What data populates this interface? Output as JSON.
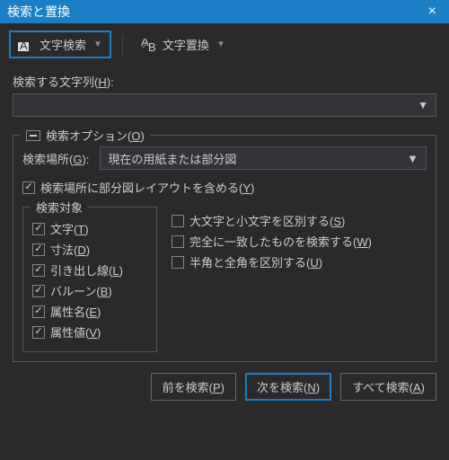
{
  "titlebar": {
    "title": "検索と置換"
  },
  "tabs": {
    "search": "文字検索",
    "replace": "文字置換"
  },
  "searchString": {
    "label": "検索する文字列(",
    "key": "H",
    "suffix": "):"
  },
  "options": {
    "legend": "検索オプション(",
    "legendKey": "O",
    "legendSuffix": ")",
    "locationLabel": "検索場所(",
    "locationKey": "G",
    "locationSuffix": "):",
    "locationValue": "現在の用紙または部分図",
    "includeLayout": "検索場所に部分図レイアウトを含める(",
    "includeLayoutKey": "Y",
    "includeLayoutSuffix": ")",
    "targetLegend": "検索対象",
    "targets": {
      "text": {
        "label": "文字(",
        "key": "T",
        "suffix": ")"
      },
      "dim": {
        "label": "寸法(",
        "key": "D",
        "suffix": ")"
      },
      "leader": {
        "label": "引き出し線(",
        "key": "L",
        "suffix": ")"
      },
      "balloon": {
        "label": "バルーン(",
        "key": "B",
        "suffix": ")"
      },
      "attrname": {
        "label": "属性名(",
        "key": "E",
        "suffix": ")"
      },
      "attrval": {
        "label": "属性値(",
        "key": "V",
        "suffix": ")"
      }
    },
    "matchCase": {
      "label": "大文字と小文字を区別する(",
      "key": "S",
      "suffix": ")"
    },
    "wholeMatch": {
      "label": "完全に一致したものを検索する(",
      "key": "W",
      "suffix": ")"
    },
    "halfFull": {
      "label": "半角と全角を区別する(",
      "key": "U",
      "suffix": ")"
    }
  },
  "buttons": {
    "prev": {
      "label": "前を検索(",
      "key": "P",
      "suffix": ")"
    },
    "next": {
      "label": "次を検索(",
      "key": "N",
      "suffix": ")"
    },
    "all": {
      "label": "すべて検索(",
      "key": "A",
      "suffix": ")"
    }
  }
}
